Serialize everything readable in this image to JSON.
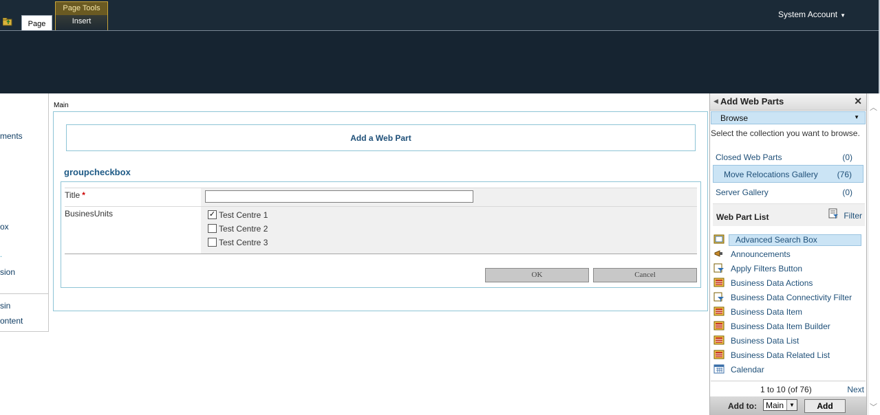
{
  "ribbon": {
    "tab_page": "Page",
    "contextual_group": "Page Tools",
    "tab_insert": "Insert",
    "account": "System Account"
  },
  "leftnav": {
    "items": [
      "ments",
      "ox",
      "sion",
      "sin",
      "ontent"
    ]
  },
  "main": {
    "zone_label": "Main",
    "add_web_part": "Add a Web Part",
    "webpart_title": "groupcheckbox",
    "form": {
      "title_label": "Title",
      "required_marker": "*",
      "title_value": "",
      "bu_label": "BusinesUnits",
      "options": [
        {
          "label": "Test Centre 1",
          "checked": true
        },
        {
          "label": "Test Centre 2",
          "checked": false
        },
        {
          "label": "Test Centre 3",
          "checked": false
        }
      ],
      "ok_label": "OK",
      "cancel_label": "Cancel"
    }
  },
  "panel": {
    "title": "Add Web Parts",
    "browse_label": "Browse",
    "instructions": "Select the collection you want to browse.",
    "collections": [
      {
        "name": "Closed Web Parts",
        "count": "(0)"
      },
      {
        "name": "Move Relocations Gallery",
        "count": "(76)"
      },
      {
        "name": "Server Gallery",
        "count": "(0)"
      }
    ],
    "list_heading": "Web Part List",
    "filter_label": "Filter",
    "webparts": [
      "Advanced Search Box",
      "Announcements",
      "Apply Filters Button",
      "Business Data Actions",
      "Business Data Connectivity Filter",
      "Business Data Item",
      "Business Data Item Builder",
      "Business Data List",
      "Business Data Related List",
      "Calendar"
    ],
    "pager_range": "1 to 10 (of 76)",
    "pager_next": "Next",
    "add_to_label": "Add to:",
    "add_to_value": "Main",
    "add_button": "Add"
  }
}
